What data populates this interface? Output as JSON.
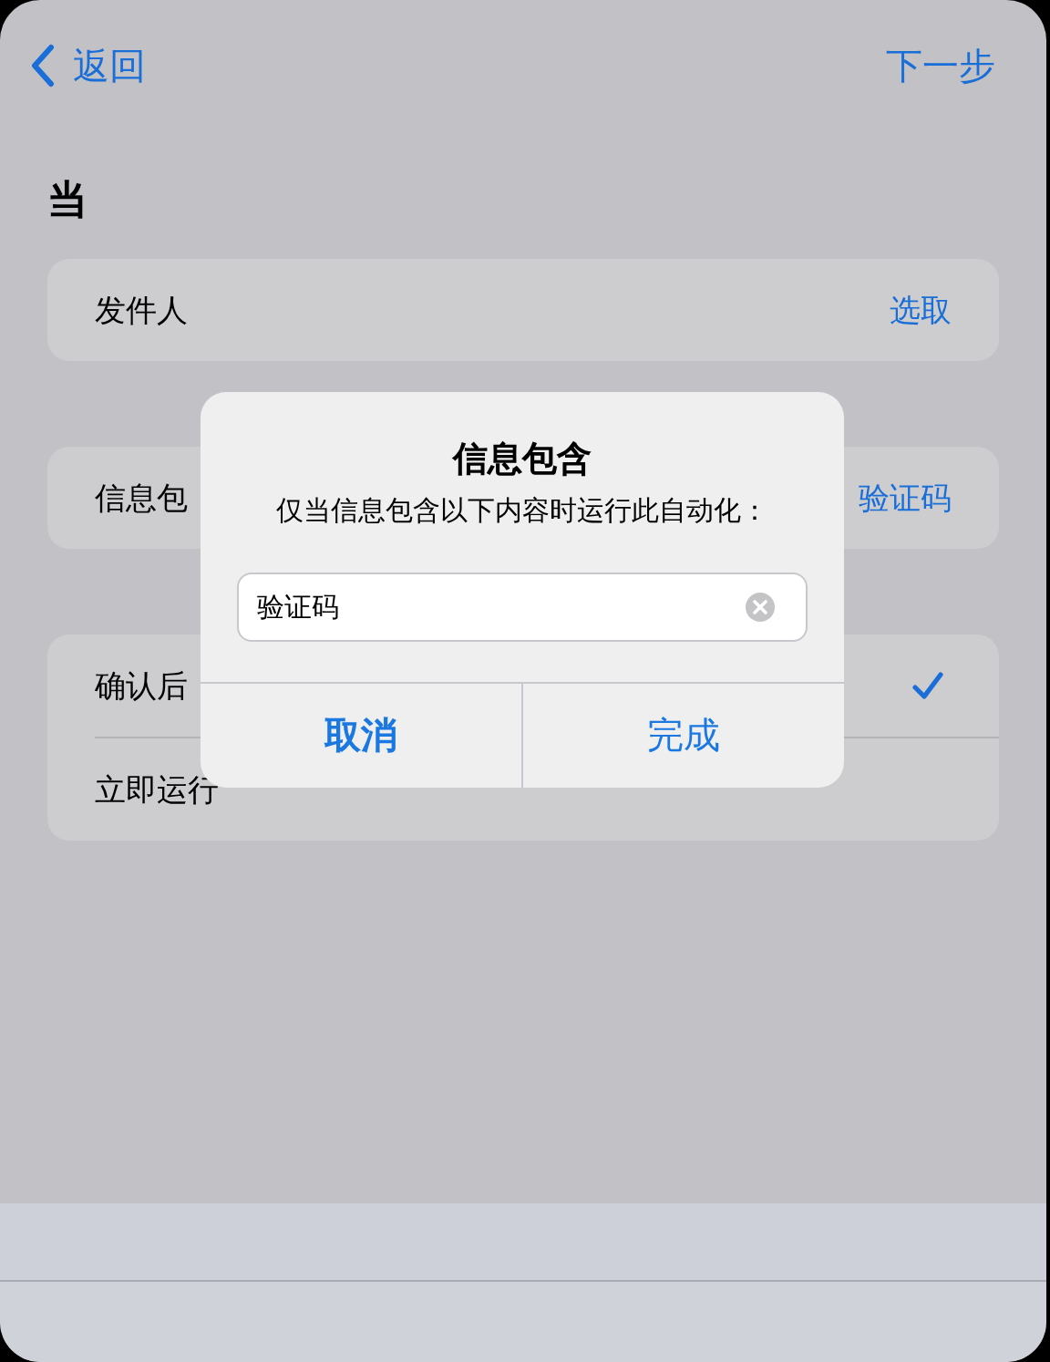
{
  "nav": {
    "back": "返回",
    "next": "下一步"
  },
  "section_title": "当",
  "sender_row": {
    "label": "发件人",
    "value": "选取"
  },
  "contains_row": {
    "label": "信息包",
    "value": "验证码"
  },
  "run_options": [
    {
      "label": "确认后",
      "checked": true
    },
    {
      "label": "立即运行",
      "checked": false
    }
  ],
  "dialog": {
    "title": "信息包含",
    "message": "仅当信息包含以下内容时运行此自动化：",
    "value": "验证码",
    "buttons": [
      {
        "label": "取消",
        "kind": "cancel"
      },
      {
        "label": "完成",
        "kind": "done"
      }
    ]
  }
}
